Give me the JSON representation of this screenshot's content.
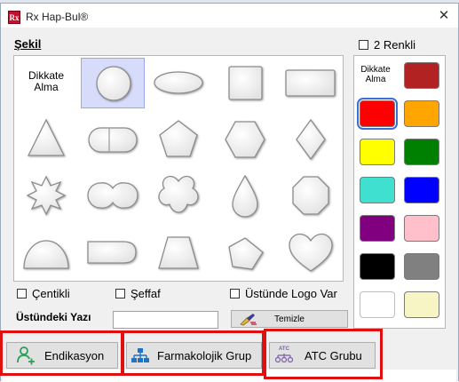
{
  "window": {
    "title": "Rx Hap-Bul®",
    "app_icon_text": "Rx",
    "close_symbol": "✕"
  },
  "sekil_label": "Şekil",
  "dikkate_text": "Dikkate\nAlma",
  "shapes": [
    {
      "name": "dikkate-alma",
      "selected": false
    },
    {
      "name": "circle",
      "selected": true
    },
    {
      "name": "ellipse",
      "selected": false
    },
    {
      "name": "square",
      "selected": false
    },
    {
      "name": "rectangle",
      "selected": false
    },
    {
      "name": "triangle",
      "selected": false
    },
    {
      "name": "capsule",
      "selected": false
    },
    {
      "name": "pentagon",
      "selected": false
    },
    {
      "name": "hexagon",
      "selected": false
    },
    {
      "name": "diamond",
      "selected": false
    },
    {
      "name": "star",
      "selected": false
    },
    {
      "name": "double-circle",
      "selected": false
    },
    {
      "name": "clover",
      "selected": false
    },
    {
      "name": "drop",
      "selected": false
    },
    {
      "name": "octagon",
      "selected": false
    },
    {
      "name": "semicircle",
      "selected": false
    },
    {
      "name": "bullet",
      "selected": false
    },
    {
      "name": "trapezoid",
      "selected": false
    },
    {
      "name": "irregular-pentagon",
      "selected": false
    },
    {
      "name": "heart",
      "selected": false
    }
  ],
  "iki_renkli_label": "2 Renkli",
  "colors": [
    {
      "name": "dikkate-alma",
      "hex": "",
      "selected": false
    },
    {
      "name": "dark-red",
      "hex": "#b22222",
      "selected": false
    },
    {
      "name": "red",
      "hex": "#ff0000",
      "selected": true
    },
    {
      "name": "orange",
      "hex": "#ffa500",
      "selected": false
    },
    {
      "name": "yellow",
      "hex": "#ffff00",
      "selected": false
    },
    {
      "name": "green",
      "hex": "#008000",
      "selected": false
    },
    {
      "name": "turquoise",
      "hex": "#40e0d0",
      "selected": false
    },
    {
      "name": "blue",
      "hex": "#0000ff",
      "selected": false
    },
    {
      "name": "purple",
      "hex": "#800080",
      "selected": false
    },
    {
      "name": "pink",
      "hex": "#ffc0cb",
      "selected": false
    },
    {
      "name": "black",
      "hex": "#000000",
      "selected": false
    },
    {
      "name": "gray",
      "hex": "#808080",
      "selected": false
    },
    {
      "name": "white",
      "hex": "#ffffff",
      "selected": false
    },
    {
      "name": "cream",
      "hex": "#f8f5c4",
      "selected": false
    }
  ],
  "options": {
    "centikli": "Çentikli",
    "seffaf": "Şeffaf",
    "ustunde_logo": "Üstünde Logo Var"
  },
  "ustundeki_yazi_label": "Üstündeki Yazı",
  "ustundeki_yazi_value": "",
  "temizle_label": "Temizle",
  "buttons": {
    "endikasyon": "Endikasyon",
    "farmakolojik": "Farmakolojik Grup",
    "atc": "ATC Grubu",
    "atc_icon_text": "ATC"
  },
  "accent_colors": {
    "highlight_frame": "#e01010",
    "selection": "#d7dcfa",
    "icon_green": "#2e9d57",
    "icon_blue": "#1e73c8",
    "icon_purple": "#7b5fa8"
  }
}
